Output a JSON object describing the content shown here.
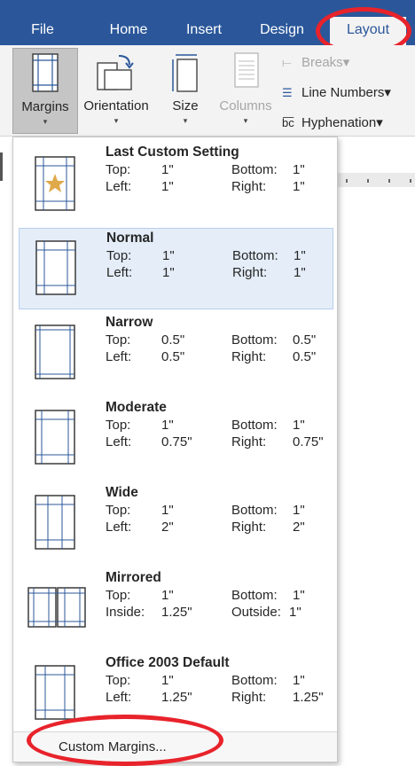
{
  "tabs": {
    "file": "File",
    "home": "Home",
    "insert": "Insert",
    "design": "Design",
    "layout": "Layout"
  },
  "ribbon": {
    "margins": "Margins",
    "orientation": "Orientation",
    "size": "Size",
    "columns": "Columns",
    "breaks": "Breaks",
    "line_numbers": "Line Numbers",
    "hyphenation": "Hyphenation",
    "dropdown_caret": "▾"
  },
  "margins_menu": {
    "options": [
      {
        "name": "Last Custom Setting",
        "k1": "Top:",
        "v1": "1\"",
        "k2": "Bottom:",
        "v2": "1\"",
        "k3": "Left:",
        "v3": "1\"",
        "k4": "Right:",
        "v4": "1\""
      },
      {
        "name": "Normal",
        "k1": "Top:",
        "v1": "1\"",
        "k2": "Bottom:",
        "v2": "1\"",
        "k3": "Left:",
        "v3": "1\"",
        "k4": "Right:",
        "v4": "1\""
      },
      {
        "name": "Narrow",
        "k1": "Top:",
        "v1": "0.5\"",
        "k2": "Bottom:",
        "v2": "0.5\"",
        "k3": "Left:",
        "v3": "0.5\"",
        "k4": "Right:",
        "v4": "0.5\""
      },
      {
        "name": "Moderate",
        "k1": "Top:",
        "v1": "1\"",
        "k2": "Bottom:",
        "v2": "1\"",
        "k3": "Left:",
        "v3": "0.75\"",
        "k4": "Right:",
        "v4": "0.75\""
      },
      {
        "name": "Wide",
        "k1": "Top:",
        "v1": "1\"",
        "k2": "Bottom:",
        "v2": "1\"",
        "k3": "Left:",
        "v3": "2\"",
        "k4": "Right:",
        "v4": "2\""
      },
      {
        "name": "Mirrored",
        "k1": "Top:",
        "v1": "1\"",
        "k2": "Bottom:",
        "v2": "1\"",
        "k3": "Inside:",
        "v3": "1.25\"",
        "k4": "Outside:",
        "v4": "1\""
      },
      {
        "name": "Office 2003 Default",
        "k1": "Top:",
        "v1": "1\"",
        "k2": "Bottom:",
        "v2": "1\"",
        "k3": "Left:",
        "v3": "1.25\"",
        "k4": "Right:",
        "v4": "1.25\""
      }
    ],
    "selected": "Normal",
    "custom_margins": "Custom Margins..."
  },
  "colors": {
    "ribbon_blue": "#2b579a",
    "annotation_red": "#e8232b",
    "selected_bg": "#e4edf8"
  },
  "icons": [
    "margins-icon",
    "orientation-icon",
    "size-icon",
    "columns-icon",
    "breaks-icon",
    "line-numbers-icon",
    "hyphenation-icon",
    "star-icon"
  ]
}
